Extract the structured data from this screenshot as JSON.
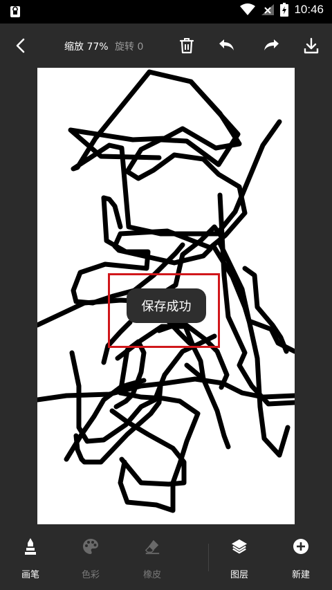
{
  "status_bar": {
    "time": "10:46",
    "icons": [
      "lock-icon",
      "wifi-icon",
      "signal-icon",
      "battery-charging-icon"
    ]
  },
  "toolbar": {
    "back_icon": "chevron-left-icon",
    "zoom_label": "缩放 77%",
    "rotate_label": "旋转 0",
    "delete_icon": "trash-icon",
    "undo_icon": "undo-icon",
    "redo_icon": "redo-icon",
    "download_icon": "download-icon"
  },
  "canvas": {
    "background": "#ffffff",
    "stroke_color": "#000000"
  },
  "toast": {
    "message": "保存成功"
  },
  "highlight": {
    "color": "#d0171b"
  },
  "bottom_bar": {
    "items": [
      {
        "label": "画笔",
        "icon": "brush-icon",
        "state": "active"
      },
      {
        "label": "色彩",
        "icon": "palette-icon",
        "state": "disabled"
      },
      {
        "label": "橡皮",
        "icon": "eraser-icon",
        "state": "disabled"
      },
      {
        "label": "图层",
        "icon": "layers-icon",
        "state": "active"
      },
      {
        "label": "新建",
        "icon": "add-circle-icon",
        "state": "active"
      }
    ]
  }
}
